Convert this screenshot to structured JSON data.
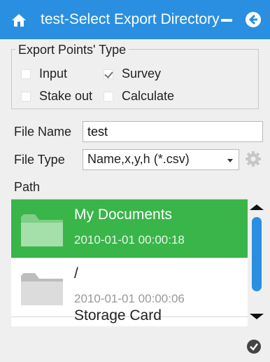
{
  "window": {
    "title": "test-Select Export Directory",
    "icons": {
      "home": "home-icon",
      "minimize": "minimize-icon",
      "back": "back-arrow-icon"
    },
    "accent_color": "#2a8fe0"
  },
  "export_points_type": {
    "legend": "Export Points' Type",
    "options": [
      {
        "label": "Input",
        "checked": false
      },
      {
        "label": "Survey",
        "checked": true
      },
      {
        "label": "Stake out",
        "checked": false
      },
      {
        "label": "Calculate",
        "checked": false
      }
    ]
  },
  "file_name": {
    "label": "File Name",
    "value": "test"
  },
  "file_type": {
    "label": "File Type",
    "selected": "Name,x,y,h (*.csv)",
    "settings_icon": "gear-icon"
  },
  "path": {
    "label": "Path",
    "items": [
      {
        "name": "My Documents",
        "date": "2010-01-01 00:00:18",
        "selected": true,
        "icon": "folder-icon"
      },
      {
        "name": "/",
        "date": "2010-01-01 00:00:06",
        "selected": false,
        "icon": "folder-icon"
      },
      {
        "name": "Storage Card",
        "date": "",
        "selected": false,
        "icon": "folder-icon"
      }
    ],
    "selected_color": "#39b549"
  },
  "confirm_icon": "check-circle-icon"
}
